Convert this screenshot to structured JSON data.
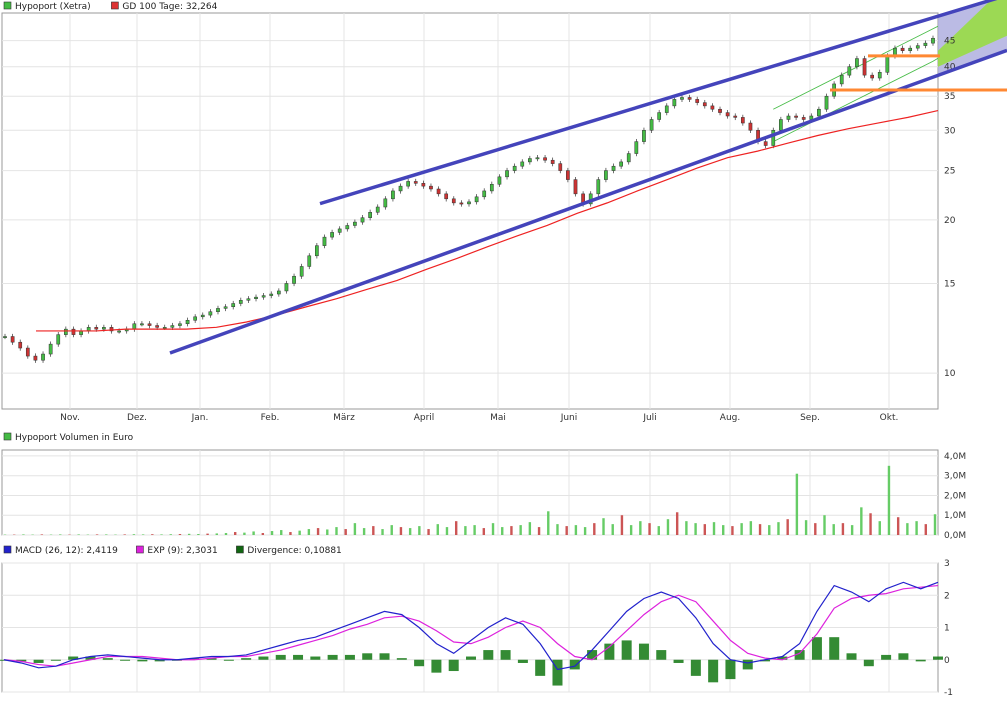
{
  "legends": {
    "price": [
      {
        "label": "Hypoport (Xetra)",
        "color": "#44bb44"
      },
      {
        "label": "GD 100 Tage: 32,264",
        "color": "#dd3333"
      }
    ],
    "volume": [
      {
        "label": "Hypoport Volumen in Euro",
        "color": "#44bb44"
      }
    ],
    "macd": [
      {
        "label": "MACD (26, 12): 2,4119",
        "color": "#2222cc"
      },
      {
        "label": "EXP (9): 2,3031",
        "color": "#dd22dd"
      },
      {
        "label": "Divergence: 0,10881",
        "color": "#116611"
      }
    ]
  },
  "chart_data": [
    {
      "type": "candlestick",
      "scale": "log",
      "ylim": [
        8.5,
        51
      ],
      "y_ticks": [
        10,
        15,
        20,
        25,
        30,
        35,
        40,
        45
      ],
      "x_labels": [
        "Nov.",
        "Dez.",
        "Jan.",
        "Feb.",
        "März",
        "April",
        "Mai",
        "Juni",
        "Juli",
        "Aug.",
        "Sep.",
        "Okt."
      ],
      "colors": {
        "up": "#44bb44",
        "down": "#cc3333",
        "ma": "#ee2222",
        "channel": "#4444bb",
        "resistance": "#ff8833",
        "forecast_fill": "#aaaadd",
        "forecast_cone": "#99dd44"
      },
      "series": [
        {
          "name": "Hypoport (Xetra)",
          "close": [
            11.8,
            11.5,
            11.2,
            10.8,
            10.6,
            10.9,
            11.4,
            11.9,
            12.2,
            11.9,
            12.1,
            12.3,
            12.2,
            12.3,
            12.1,
            12.1,
            12.2,
            12.5,
            12.5,
            12.4,
            12.3,
            12.3,
            12.4,
            12.5,
            12.7,
            12.9,
            13.0,
            13.2,
            13.4,
            13.5,
            13.7,
            13.9,
            14.0,
            14.1,
            14.2,
            14.3,
            14.5,
            15.0,
            15.5,
            16.2,
            17.0,
            17.8,
            18.5,
            18.9,
            19.2,
            19.5,
            19.8,
            20.2,
            20.7,
            21.2,
            22.0,
            22.8,
            23.3,
            23.8,
            23.6,
            23.3,
            23.0,
            22.5,
            22.0,
            21.6,
            21.5,
            21.7,
            22.2,
            22.8,
            23.5,
            24.3,
            25.0,
            25.5,
            26.0,
            26.4,
            26.5,
            26.2,
            25.8,
            25.0,
            24.0,
            22.5,
            21.5,
            22.5,
            24.0,
            25.0,
            25.5,
            26.0,
            27.0,
            28.5,
            30.0,
            31.5,
            32.5,
            33.5,
            34.5,
            34.8,
            34.5,
            34.0,
            33.5,
            33.0,
            32.5,
            32.0,
            31.8,
            31.0,
            30.0,
            28.5,
            28.0,
            30.0,
            31.5,
            32.0,
            31.8,
            31.5,
            32.0,
            33.0,
            35.0,
            37.0,
            38.5,
            40.0,
            41.5,
            38.5,
            38.0,
            39.0,
            42.0,
            43.5,
            43.0,
            43.5,
            44.0,
            44.5,
            45.5
          ]
        },
        {
          "name": "GD 100 Tage",
          "values": [
            12.1,
            12.1,
            12.1,
            12.2,
            12.2,
            12.2,
            12.3,
            12.6,
            13.0,
            13.5,
            14.0,
            14.6,
            15.2,
            16.0,
            16.8,
            17.7,
            18.6,
            19.5,
            20.6,
            21.6,
            22.8,
            24.0,
            25.3,
            26.5,
            27.3,
            28.3,
            29.3,
            30.2,
            31.0,
            31.8,
            32.8
          ]
        }
      ],
      "channel_lines": [
        {
          "from": {
            "x": "Feb.",
            "y": 20.1
          },
          "to": {
            "x": "Okt.",
            "y": 47.0
          }
        },
        {
          "from": {
            "x": "Jan.",
            "y": 11.5
          },
          "to": {
            "x": "Okt.",
            "y": 35.5
          }
        }
      ],
      "horizontal_levels": [
        42.0,
        36.0
      ]
    },
    {
      "type": "bar",
      "y_ticks": [
        "0,0M",
        "1,0M",
        "2,0M",
        "3,0M",
        "4,0M"
      ],
      "ylim": [
        0,
        4.3
      ],
      "series": [
        {
          "name": "Hypoport Volumen in Euro",
          "values": [
            0.02,
            0.02,
            0.03,
            0.02,
            0.03,
            0.02,
            0.03,
            0.02,
            0.03,
            0.02,
            0.03,
            0.03,
            0.02,
            0.03,
            0.04,
            0.03,
            0.04,
            0.03,
            0.04,
            0.05,
            0.06,
            0.05,
            0.07,
            0.08,
            0.1,
            0.15,
            0.12,
            0.18,
            0.1,
            0.2,
            0.25,
            0.15,
            0.22,
            0.3,
            0.35,
            0.28,
            0.4,
            0.3,
            0.6,
            0.35,
            0.45,
            0.3,
            0.5,
            0.4,
            0.35,
            0.45,
            0.3,
            0.55,
            0.4,
            0.7,
            0.45,
            0.5,
            0.35,
            0.6,
            0.4,
            0.45,
            0.5,
            0.65,
            0.4,
            1.2,
            0.55,
            0.45,
            0.5,
            0.4,
            0.6,
            0.85,
            0.55,
            1.0,
            0.5,
            0.7,
            0.6,
            0.45,
            0.8,
            1.15,
            0.7,
            0.6,
            0.55,
            0.65,
            0.5,
            0.45,
            0.6,
            0.7,
            0.55,
            0.5,
            0.65,
            0.8,
            3.1,
            0.75,
            0.6,
            1.0,
            0.55,
            0.6,
            0.5,
            1.4,
            1.1,
            0.7,
            3.5,
            0.9,
            0.6,
            0.7,
            0.55,
            1.05
          ]
        }
      ]
    },
    {
      "type": "line",
      "y_ticks": [
        -1,
        0,
        1,
        2,
        3
      ],
      "ylim": [
        -1,
        3
      ],
      "series": [
        {
          "name": "MACD (26, 12)",
          "values": [
            0.0,
            -0.1,
            -0.25,
            -0.2,
            0.0,
            0.1,
            0.15,
            0.1,
            0.05,
            0.0,
            0.0,
            0.05,
            0.1,
            0.1,
            0.15,
            0.3,
            0.45,
            0.6,
            0.7,
            0.9,
            1.1,
            1.3,
            1.5,
            1.4,
            1.0,
            0.5,
            0.2,
            0.6,
            1.0,
            1.3,
            1.1,
            0.5,
            -0.3,
            -0.2,
            0.3,
            0.9,
            1.5,
            1.9,
            2.1,
            1.9,
            1.3,
            0.5,
            0.0,
            -0.1,
            0.0,
            0.1,
            0.5,
            1.5,
            2.3,
            2.1,
            1.8,
            2.2,
            2.4,
            2.2,
            2.4
          ]
        },
        {
          "name": "EXP (9)",
          "values": [
            0.0,
            -0.05,
            -0.15,
            -0.2,
            -0.1,
            0.0,
            0.1,
            0.1,
            0.1,
            0.05,
            0.0,
            0.0,
            0.05,
            0.1,
            0.1,
            0.2,
            0.3,
            0.45,
            0.6,
            0.75,
            0.95,
            1.1,
            1.3,
            1.35,
            1.2,
            0.9,
            0.55,
            0.5,
            0.7,
            1.0,
            1.2,
            1.0,
            0.5,
            0.1,
            0.0,
            0.4,
            0.9,
            1.4,
            1.8,
            2.0,
            1.8,
            1.2,
            0.6,
            0.2,
            0.05,
            0.0,
            0.2,
            0.8,
            1.6,
            1.9,
            2.0,
            2.05,
            2.2,
            2.25,
            2.3
          ]
        },
        {
          "name": "Divergence",
          "values": [
            0.0,
            -0.05,
            -0.1,
            0.0,
            0.1,
            0.1,
            0.05,
            0.0,
            -0.05,
            -0.05,
            0.0,
            0.05,
            0.05,
            0.0,
            0.05,
            0.1,
            0.15,
            0.15,
            0.1,
            0.15,
            0.15,
            0.2,
            0.2,
            0.05,
            -0.2,
            -0.4,
            -0.35,
            0.1,
            0.3,
            0.3,
            -0.1,
            -0.5,
            -0.8,
            -0.3,
            0.3,
            0.5,
            0.6,
            0.5,
            0.3,
            -0.1,
            -0.5,
            -0.7,
            -0.6,
            -0.3,
            -0.05,
            0.1,
            0.3,
            0.7,
            0.7,
            0.2,
            -0.2,
            0.15,
            0.2,
            -0.05,
            0.1
          ]
        }
      ]
    }
  ]
}
